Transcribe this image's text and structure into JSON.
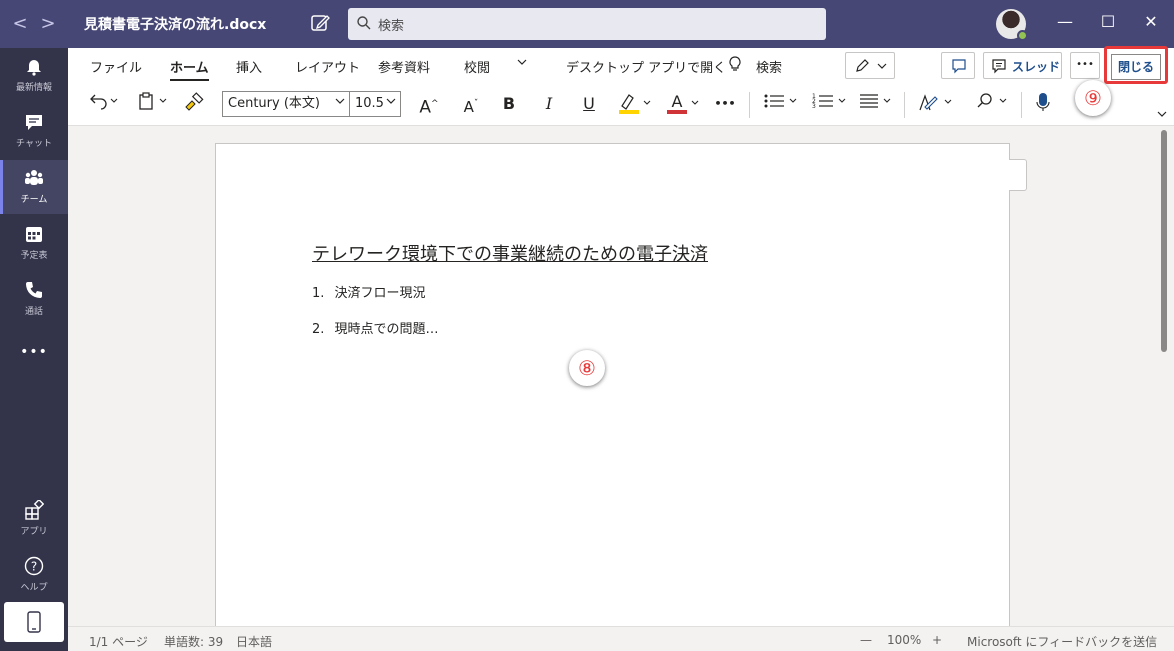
{
  "titlebar": {
    "back": "<",
    "forward": ">",
    "title": "見積書電子決済の流れ.docx",
    "search_placeholder": "検索",
    "minimize": "—",
    "maximize": "☐",
    "close": "✕"
  },
  "rail": {
    "items": [
      {
        "label": "最新情報",
        "icon": "bell-icon"
      },
      {
        "label": "チャット",
        "icon": "chat-icon"
      },
      {
        "label": "チーム",
        "icon": "teams-icon"
      },
      {
        "label": "予定表",
        "icon": "calendar-icon"
      },
      {
        "label": "通話",
        "icon": "phone-icon"
      },
      {
        "label": "•••",
        "icon": "more-icon"
      },
      {
        "label": "アプリ",
        "icon": "apps-icon"
      },
      {
        "label": "ヘルプ",
        "icon": "help-icon"
      }
    ]
  },
  "ribbon": {
    "tabs": [
      "ファイル",
      "ホーム",
      "挿入",
      "レイアウト",
      "参考資料",
      "校閲"
    ],
    "open_desktop": "デスクトップ アプリで開く",
    "search": "検索",
    "thread": "スレッド",
    "more": "•••",
    "close": "閉じる",
    "font_name": "Century (本文)",
    "font_size": "10.5",
    "bold": "B",
    "italic": "I",
    "underline": "U",
    "grow": "A",
    "shrink": "A",
    "highlight": "A",
    "fontcolor": "A",
    "more_tools": "•••"
  },
  "callouts": {
    "nine": "⑨",
    "eight": "⑧"
  },
  "document": {
    "title": "テレワーク環境下での事業継続のための電子決済",
    "items": [
      {
        "num": "1.",
        "text": "決済フロー現況"
      },
      {
        "num": "2.",
        "text": "現時点での問題…"
      }
    ]
  },
  "status": {
    "page": "1/1 ページ",
    "words": "単語数: 39",
    "language": "日本語",
    "zoom_out": "—",
    "zoom": "100%",
    "zoom_in": "+",
    "feedback": "Microsoft にフィードバックを送信"
  },
  "colors": {
    "titlebar": "#464775",
    "rail": "#33344a",
    "close_highlight": "#e8393a",
    "highlight_yellow": "#ffd400",
    "font_red": "#d13438"
  }
}
